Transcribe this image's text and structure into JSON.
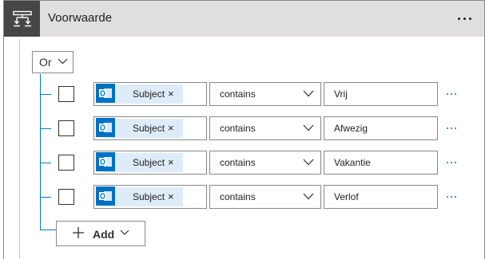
{
  "header": {
    "title": "Voorwaarde",
    "icon": "condition-icon"
  },
  "group": {
    "operator": "Or"
  },
  "rows": [
    {
      "field": "Subject",
      "operator": "contains",
      "value": "Vrij"
    },
    {
      "field": "Subject",
      "operator": "contains",
      "value": "Afwezig"
    },
    {
      "field": "Subject",
      "operator": "contains",
      "value": "Vakantie"
    },
    {
      "field": "Subject",
      "operator": "contains",
      "value": "Verlof"
    }
  ],
  "add_button": {
    "label": "Add"
  },
  "colors": {
    "header_bg": "#e1dfdd",
    "header_icon_bg": "#484644",
    "accent": "#0078d4",
    "token_bg": "#deecf9"
  }
}
